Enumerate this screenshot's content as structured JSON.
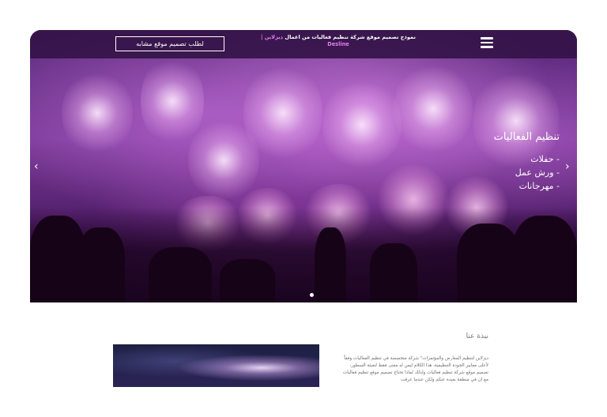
{
  "header": {
    "cta_label": "لطلب تصميم موقع مشابه",
    "note_prefix": "نموذج تصميم موقع شركة تنظيم فعاليات من اعمال",
    "note_brand": "ديزلاين |",
    "note_author": "Desline",
    "menu_icon": "hamburger-icon"
  },
  "hero": {
    "title": "تنظيم الفعاليات",
    "items": [
      "- حفلات",
      "- ورش عمل",
      "- مهرجانات"
    ],
    "prev_icon": "chevron-left-icon",
    "next_icon": "chevron-right-icon",
    "prev_glyph": "‹",
    "next_glyph": "›"
  },
  "about": {
    "title": "نبذة عنا",
    "text": "ديزلاين لتنظيم المعارض والمؤتمرات\" شركة متخصصة في تنظيم الفعاليات وفقاً لأعلى معايير الجودة التنظيمية، هذا الكلام ليس له معنى فقط لتعبئة السطور، تصميم موقع شركة تنظيم فعاليات ولذلك لماذا تحتاج تصميم موقع تنظيم فعاليات مع ان في منطقة بعيدة عنكم ولكن عندما عرفت"
  },
  "colors": {
    "accent": "#e27ff0",
    "topbar": "#34144a"
  }
}
